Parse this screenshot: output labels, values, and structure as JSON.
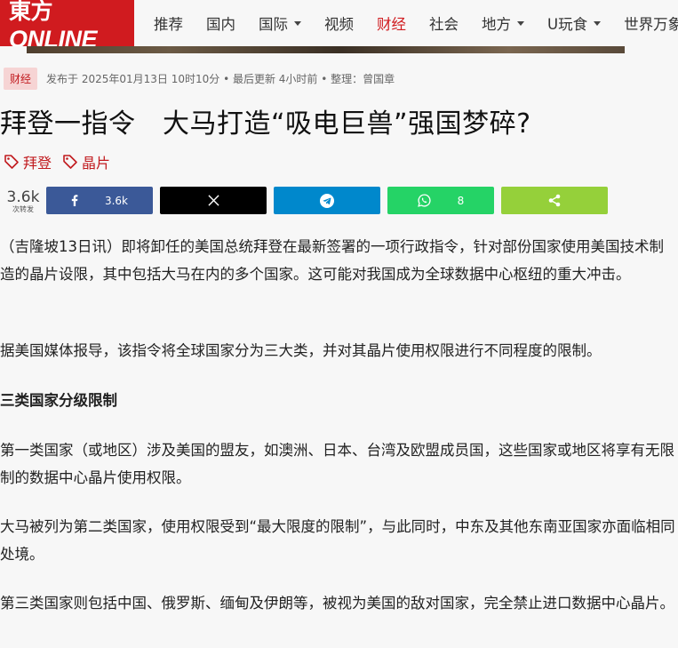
{
  "nav": {
    "logo_latin": "ONLINE",
    "logo_cn": "東方",
    "items": [
      {
        "label": "推荐",
        "dropdown": false,
        "active": false
      },
      {
        "label": "国内",
        "dropdown": false,
        "active": false
      },
      {
        "label": "国际",
        "dropdown": true,
        "active": false
      },
      {
        "label": "视频",
        "dropdown": false,
        "active": false
      },
      {
        "label": "财经",
        "dropdown": false,
        "active": true
      },
      {
        "label": "社会",
        "dropdown": false,
        "active": false
      },
      {
        "label": "地方",
        "dropdown": true,
        "active": false
      },
      {
        "label": "U玩食",
        "dropdown": true,
        "active": false
      },
      {
        "label": "世界万象",
        "dropdown": false,
        "active": false
      }
    ],
    "active_color": "#d01b1f"
  },
  "article": {
    "category": "财经",
    "meta": "发布于 2025年01月13日 10时10分 • 最后更新 4小时前 • 整理：曾国章",
    "title": "拜登一指令　大马打造“吸电巨兽”强国梦碎?",
    "tags": [
      "拜登",
      "晶片"
    ],
    "paragraphs": [
      "（吉隆坡13日讯）即将卸任的美国总统拜登在最新签署的一项行政指令，针对部份国家使用美国技术制造的晶片设限，其中包括大马在内的多个国家。这可能对我国成为全球数据中心枢纽的重大冲击。",
      "据美国媒体报导，该指令将全球国家分为三大类，并对其晶片使用权限进行不同程度的限制。",
      "第一类国家（或地区）涉及美国的盟友，如澳洲、日本、台湾及欧盟成员国，这些国家或地区将享有无限制的数据中心晶片使用权限。",
      "大马被列为第二类国家，使用权限受到“最大限度的限制”，与此同时，中东及其他东南亚国家亦面临相同处境。",
      "第三类国家则包括中国、俄罗斯、缅甸及伊朗等，被视为美国的敌对国家，完全禁止进口数据中心晶片。"
    ],
    "subheading": "三类国家分级限制"
  },
  "share": {
    "total": "3.6k",
    "total_label": "次转发",
    "facebook_count": "3.6k",
    "whatsapp_count": "8",
    "colors": {
      "facebook": "#3b5998",
      "x": "#000000",
      "telegram": "#0088cc",
      "whatsapp": "#25d366",
      "share": "#95d03a"
    }
  }
}
